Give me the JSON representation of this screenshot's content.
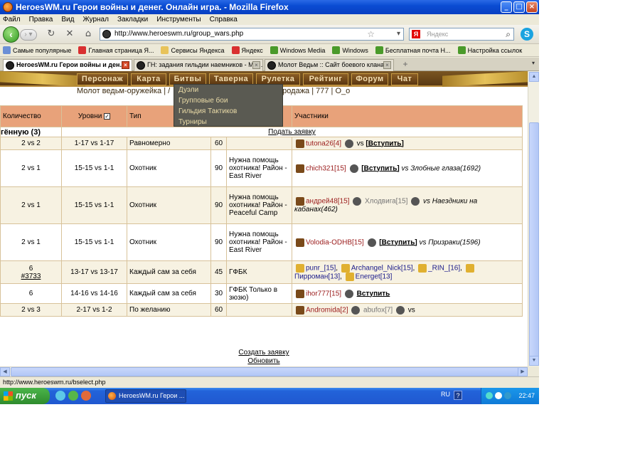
{
  "window": {
    "title": "HeroesWM.ru Герои войны и денег. Онлайн игра. - Mozilla Firefox"
  },
  "menubar": [
    "Файл",
    "Правка",
    "Вид",
    "Журнал",
    "Закладки",
    "Инструменты",
    "Справка"
  ],
  "address": {
    "url": "http://www.heroeswm.ru/group_wars.php"
  },
  "search": {
    "placeholder": "Яндекс"
  },
  "bookmarks": [
    {
      "label": "Самые популярные",
      "icon": "bookmark-icon",
      "color": "#6b8fd6"
    },
    {
      "label": "Главная страница Я...",
      "icon": "yandex-icon",
      "color": "#d93030"
    },
    {
      "label": "Сервисы Яндекса",
      "icon": "folder-icon",
      "color": "#e8c35a"
    },
    {
      "label": "Яндекс",
      "icon": "yandex-icon",
      "color": "#d93030"
    },
    {
      "label": "Windows Media",
      "icon": "windows-icon",
      "color": "#4a9a2a"
    },
    {
      "label": "Windows",
      "icon": "windows-icon",
      "color": "#4a9a2a"
    },
    {
      "label": "Бесплатная почта Н...",
      "icon": "mail-icon",
      "color": "#4a9a2a"
    },
    {
      "label": "Настройка ссылок",
      "icon": "settings-icon",
      "color": "#4a9a2a"
    }
  ],
  "tabs": [
    {
      "label": "HeroesWM.ru Герои войны и ден...",
      "active": true
    },
    {
      "label": "ГН: задания гильдии наемников - Мо...",
      "active": false
    },
    {
      "label": "Молот Ведьм :: Сайт боевого клана ...",
      "active": false
    }
  ],
  "gamenav": [
    "Персонаж",
    "Карта",
    "Битвы",
    "Таверна",
    "Рулетка",
    "Рейтинг",
    "Форум",
    "Чат"
  ],
  "dropdown": [
    "Дуэли",
    "Групповые бои",
    "Гильдия Тактиков",
    "Турниры"
  ],
  "infoline": {
    "left": "Молот ведьм-оружейка | /",
    "right": "21 | продажа | 777 | О_о"
  },
  "table": {
    "headers": [
      "Количество",
      "Уровни",
      "Тип",
      "",
      "",
      "Участники"
    ],
    "section": {
      "label": "гённую (3)",
      "link": "Подать заявку"
    },
    "rows": [
      {
        "count": "2 vs 2",
        "levels": "1-17 vs 1-17",
        "type": "Равномерно",
        "time": "60",
        "note": "",
        "p1": "tutona26[4]",
        "vs": "vs",
        "join": "[Вступить]",
        "tail": ""
      },
      {
        "count": "2 vs 1",
        "levels": "15-15 vs 1-1",
        "type": "Охотник",
        "time": "90",
        "note": "Нужна помощь охотника! Район - East River",
        "p1": "chich321[15]",
        "vs": "",
        "join": "[Вступить]",
        "tail": "vs Злобные глаза(1692)"
      },
      {
        "count": "2 vs 1",
        "levels": "15-15 vs 1-1",
        "type": "Охотник",
        "time": "90",
        "note": "Нужна помощь охотника! Район - Peaceful Camp",
        "p1": "андрей48[15]",
        "p2": "Хлодвига[15]",
        "vs": "",
        "join": "",
        "tail": "vs Наездники на кабанах(462)"
      },
      {
        "count": "2 vs 1",
        "levels": "15-15 vs 1-1",
        "type": "Охотник",
        "time": "90",
        "note": "Нужна помощь охотника! Район - East River",
        "p1": "Volodia-ODHB[15]",
        "vs": "",
        "join": "[Вступить]",
        "tail": "vs Призраки(1596)"
      },
      {
        "count": "6",
        "count_link": "#3733",
        "levels": "13-17 vs 13-17",
        "type": "Каждый сам за себя",
        "time": "45",
        "note": "ГФБК",
        "players": [
          "punr_[15]",
          "Archangel_Nick[15]",
          "_RIN_[16]",
          "Пирроман[13]",
          "Energet[13]"
        ]
      },
      {
        "count": "6",
        "levels": "14-16 vs 14-16",
        "type": "Каждый сам за себя",
        "time": "30",
        "note": "ГФБК Только в зюзю)",
        "p1": "ihor777[15]",
        "vs": "",
        "join": "Вступить",
        "tail": ""
      },
      {
        "count": "2 vs 3",
        "levels": "2-17 vs 1-2",
        "type": "По желанию",
        "time": "60",
        "note": "",
        "p1": "Andromida[2]",
        "p2": "abufox[7]",
        "vs": "vs",
        "join": "",
        "tail": ""
      }
    ]
  },
  "footer": {
    "create": "Создать заявку",
    "refresh": "Обновить"
  },
  "statusbar": {
    "text": "http://www.heroeswm.ru/bselect.php"
  },
  "taskbar": {
    "start": "пуск",
    "task": "HeroesWM.ru Герои ...",
    "lang": "RU",
    "clock": "22:47"
  }
}
